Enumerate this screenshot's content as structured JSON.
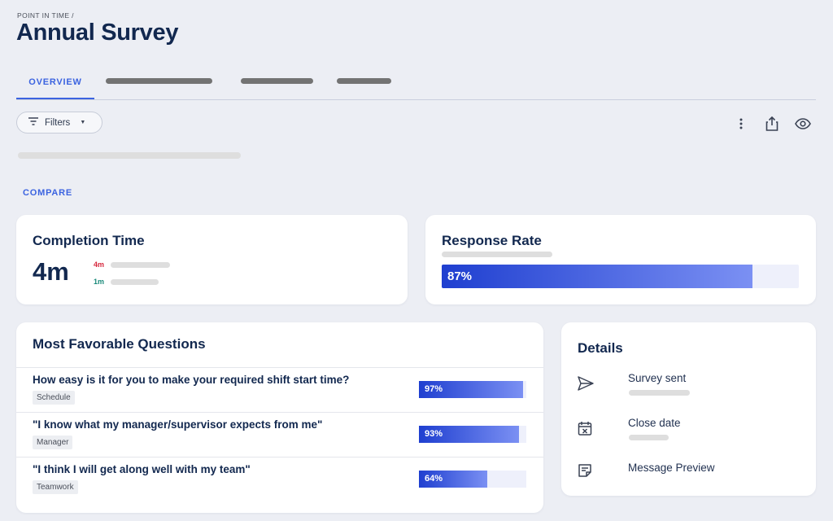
{
  "header": {
    "breadcrumb": "POINT IN TIME /",
    "title": "Annual Survey"
  },
  "tabs": {
    "active_label": "OVERVIEW"
  },
  "toolbar": {
    "filters_label": "Filters",
    "icons": [
      "filter-icon",
      "caret-down-icon",
      "more-vertical-icon",
      "share-icon",
      "eye-icon"
    ]
  },
  "compare": {
    "label": "COMPARE"
  },
  "completion_time": {
    "title": "Completion Time",
    "value": "4m",
    "comparisons": [
      {
        "value": "4m",
        "color": "#d6293e"
      },
      {
        "value": "1m",
        "color": "#1a8a7a"
      }
    ]
  },
  "response_rate": {
    "title": "Response Rate",
    "value_label": "87%",
    "fraction": 0.87
  },
  "favorable": {
    "title": "Most Favorable Questions",
    "questions": [
      {
        "text": "How easy is it for you to make your required shift start time?",
        "tag": "Schedule",
        "pct_label": "97%",
        "fraction": 0.97
      },
      {
        "text": "\"I know what my manager/supervisor expects from me\"",
        "tag": "Manager",
        "pct_label": "93%",
        "fraction": 0.93
      },
      {
        "text": "\"I think I will get along well with my team\"",
        "tag": "Teamwork",
        "pct_label": "64%",
        "fraction": 0.64
      }
    ]
  },
  "details": {
    "title": "Details",
    "items": [
      {
        "label": "Survey sent",
        "icon": "send-icon"
      },
      {
        "label": "Close date",
        "icon": "calendar-close-icon"
      },
      {
        "label": "Message Preview",
        "icon": "message-preview-icon"
      }
    ]
  },
  "colors": {
    "accent": "#3b63e0",
    "navy": "#12284f",
    "bar_start": "#1f3fd0",
    "bar_end": "#7b90f3"
  }
}
